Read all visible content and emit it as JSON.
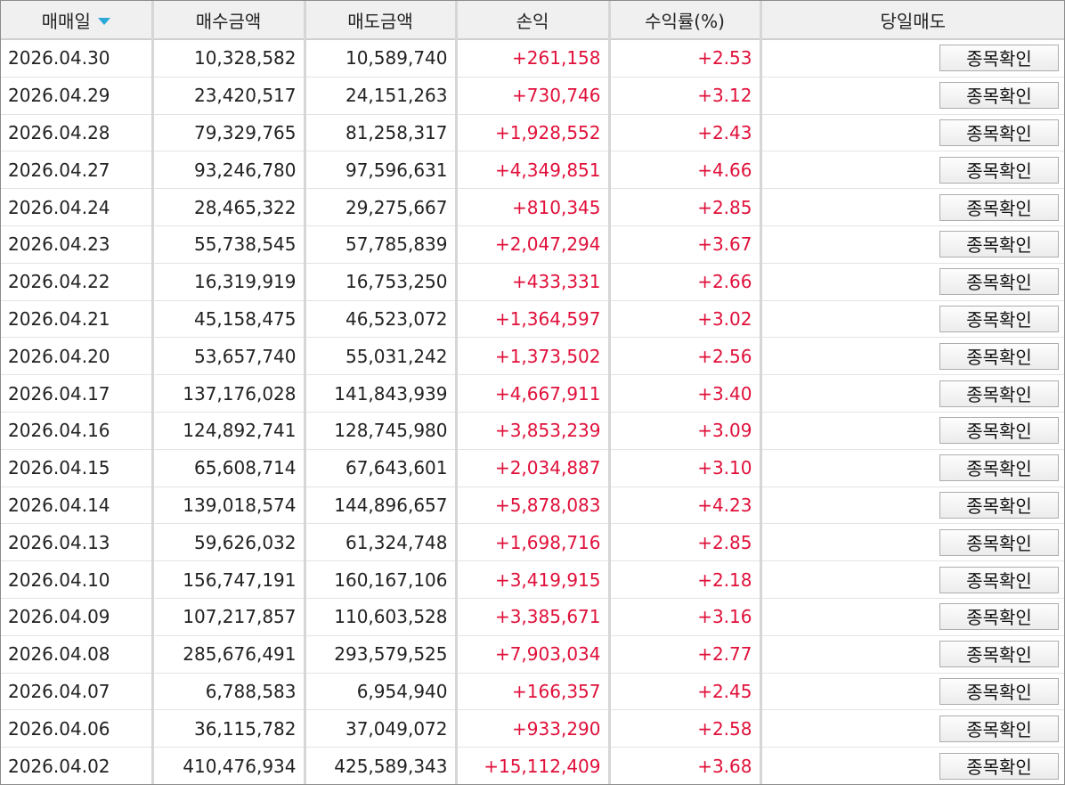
{
  "table": {
    "columns": [
      "매매일",
      "매수금액",
      "매도금액",
      "손익",
      "수익률(%)",
      "당일매도"
    ],
    "sort_column": "매매일",
    "sort_direction": "descending",
    "sort_icon": "sort-down-triangle-icon",
    "button_label": "종목확인",
    "positive_color": "#e0103a",
    "rows": [
      {
        "date": "2026.04.30",
        "buy": "10,328,582",
        "sell": "10,589,740",
        "pnl": "+261,158",
        "rate": "+2.53"
      },
      {
        "date": "2026.04.29",
        "buy": "23,420,517",
        "sell": "24,151,263",
        "pnl": "+730,746",
        "rate": "+3.12"
      },
      {
        "date": "2026.04.28",
        "buy": "79,329,765",
        "sell": "81,258,317",
        "pnl": "+1,928,552",
        "rate": "+2.43"
      },
      {
        "date": "2026.04.27",
        "buy": "93,246,780",
        "sell": "97,596,631",
        "pnl": "+4,349,851",
        "rate": "+4.66"
      },
      {
        "date": "2026.04.24",
        "buy": "28,465,322",
        "sell": "29,275,667",
        "pnl": "+810,345",
        "rate": "+2.85"
      },
      {
        "date": "2026.04.23",
        "buy": "55,738,545",
        "sell": "57,785,839",
        "pnl": "+2,047,294",
        "rate": "+3.67"
      },
      {
        "date": "2026.04.22",
        "buy": "16,319,919",
        "sell": "16,753,250",
        "pnl": "+433,331",
        "rate": "+2.66"
      },
      {
        "date": "2026.04.21",
        "buy": "45,158,475",
        "sell": "46,523,072",
        "pnl": "+1,364,597",
        "rate": "+3.02"
      },
      {
        "date": "2026.04.20",
        "buy": "53,657,740",
        "sell": "55,031,242",
        "pnl": "+1,373,502",
        "rate": "+2.56"
      },
      {
        "date": "2026.04.17",
        "buy": "137,176,028",
        "sell": "141,843,939",
        "pnl": "+4,667,911",
        "rate": "+3.40"
      },
      {
        "date": "2026.04.16",
        "buy": "124,892,741",
        "sell": "128,745,980",
        "pnl": "+3,853,239",
        "rate": "+3.09"
      },
      {
        "date": "2026.04.15",
        "buy": "65,608,714",
        "sell": "67,643,601",
        "pnl": "+2,034,887",
        "rate": "+3.10"
      },
      {
        "date": "2026.04.14",
        "buy": "139,018,574",
        "sell": "144,896,657",
        "pnl": "+5,878,083",
        "rate": "+4.23"
      },
      {
        "date": "2026.04.13",
        "buy": "59,626,032",
        "sell": "61,324,748",
        "pnl": "+1,698,716",
        "rate": "+2.85"
      },
      {
        "date": "2026.04.10",
        "buy": "156,747,191",
        "sell": "160,167,106",
        "pnl": "+3,419,915",
        "rate": "+2.18"
      },
      {
        "date": "2026.04.09",
        "buy": "107,217,857",
        "sell": "110,603,528",
        "pnl": "+3,385,671",
        "rate": "+3.16"
      },
      {
        "date": "2026.04.08",
        "buy": "285,676,491",
        "sell": "293,579,525",
        "pnl": "+7,903,034",
        "rate": "+2.77"
      },
      {
        "date": "2026.04.07",
        "buy": "6,788,583",
        "sell": "6,954,940",
        "pnl": "+166,357",
        "rate": "+2.45"
      },
      {
        "date": "2026.04.06",
        "buy": "36,115,782",
        "sell": "37,049,072",
        "pnl": "+933,290",
        "rate": "+2.58"
      },
      {
        "date": "2026.04.02",
        "buy": "410,476,934",
        "sell": "425,589,343",
        "pnl": "+15,112,409",
        "rate": "+3.68"
      }
    ]
  }
}
